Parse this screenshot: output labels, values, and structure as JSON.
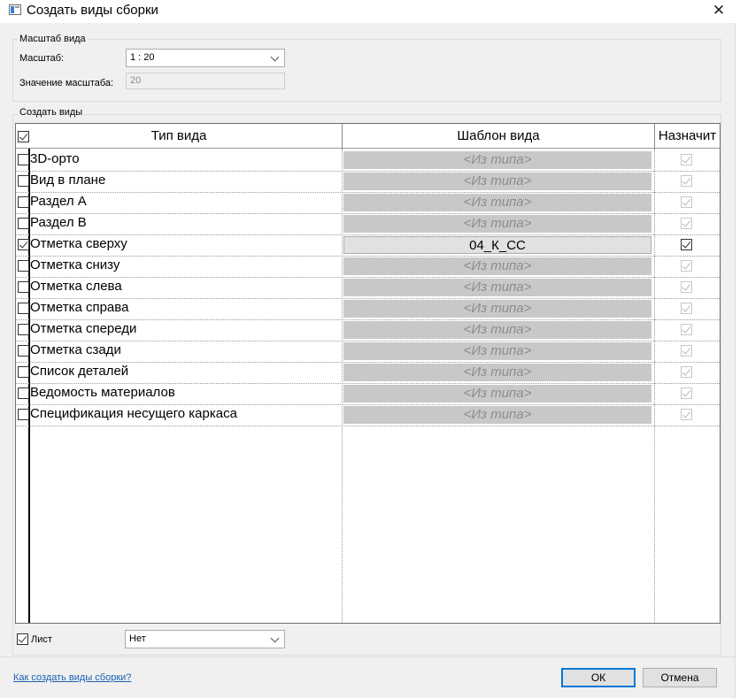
{
  "window": {
    "title": "Создать виды сборки",
    "close_glyph": "✕"
  },
  "scale_group": {
    "label": "Масштаб вида",
    "scale_label": "Масштаб:",
    "scale_value": "1 : 20",
    "scale_value_label": "Значение масштаба:",
    "scale_value_number": "20"
  },
  "views_group": {
    "label": "Создать виды"
  },
  "table": {
    "headers": {
      "view_type": "Тип вида",
      "template": "Шаблон вида",
      "assign": "Назначит"
    },
    "header_checked": true,
    "rows": [
      {
        "name": "3D-орто",
        "checked": false,
        "template": "<Из типа>",
        "active": false
      },
      {
        "name": "Вид в плане",
        "checked": false,
        "template": "<Из типа>",
        "active": false
      },
      {
        "name": "Раздел А",
        "checked": false,
        "template": "<Из типа>",
        "active": false
      },
      {
        "name": "Раздел В",
        "checked": false,
        "template": "<Из типа>",
        "active": false
      },
      {
        "name": "Отметка сверху",
        "checked": true,
        "template": "04_К_СС",
        "active": true
      },
      {
        "name": "Отметка снизу",
        "checked": false,
        "template": "<Из типа>",
        "active": false
      },
      {
        "name": "Отметка слева",
        "checked": false,
        "template": "<Из типа>",
        "active": false
      },
      {
        "name": "Отметка справа",
        "checked": false,
        "template": "<Из типа>",
        "active": false
      },
      {
        "name": "Отметка спереди",
        "checked": false,
        "template": "<Из типа>",
        "active": false
      },
      {
        "name": "Отметка сзади",
        "checked": false,
        "template": "<Из типа>",
        "active": false
      },
      {
        "name": "Список деталей",
        "checked": false,
        "template": "<Из типа>",
        "active": false
      },
      {
        "name": "Ведомость материалов",
        "checked": false,
        "template": "<Из типа>",
        "active": false
      },
      {
        "name": "Спецификация несущего каркаса",
        "checked": false,
        "template": "<Из типа>",
        "active": false
      }
    ]
  },
  "sheet": {
    "label": "Лист",
    "checked": true,
    "value": "Нет"
  },
  "footer": {
    "help_link": "Как создать виды сборки?",
    "ok_label": "ОК",
    "cancel_label": "Отмена"
  }
}
